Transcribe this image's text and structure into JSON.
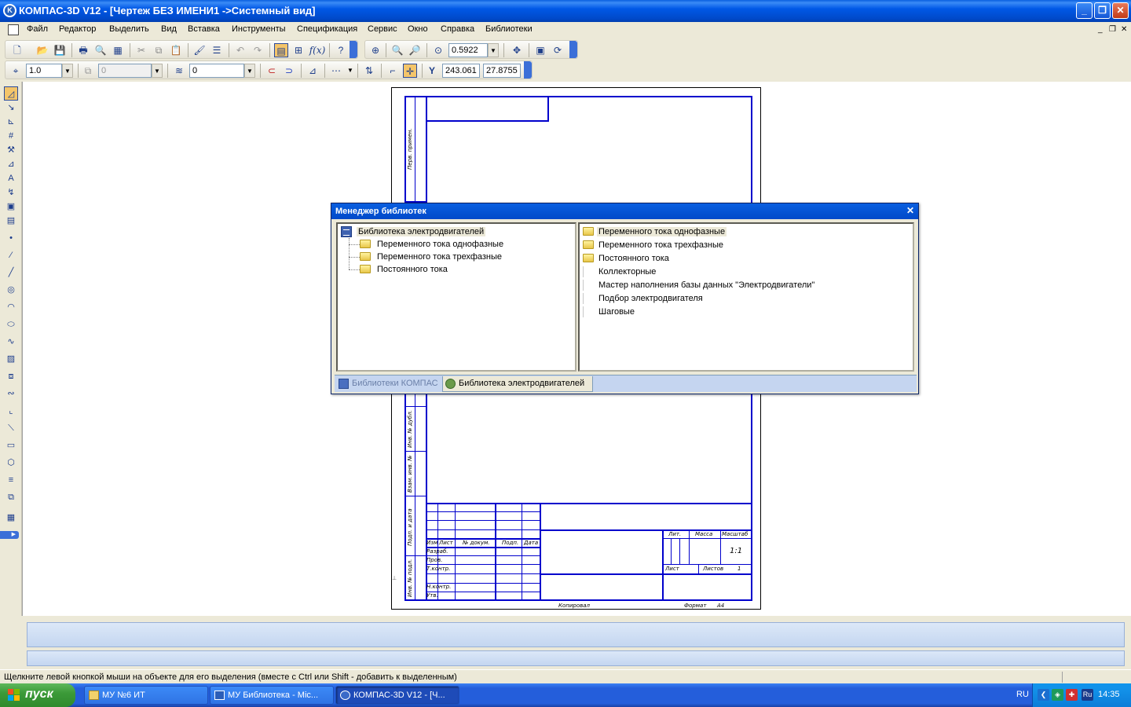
{
  "window": {
    "title": "КОМПАС-3D V12 - [Чертеж БЕЗ ИМЕНИ1 ->Системный вид]",
    "controls": [
      "_",
      "❐",
      "✕"
    ]
  },
  "menu": {
    "items": [
      {
        "label": "Файл",
        "name": "menu-file"
      },
      {
        "label": "Редактор",
        "name": "menu-edit"
      },
      {
        "label": "Выделить",
        "name": "menu-select"
      },
      {
        "label": "Вид",
        "name": "menu-view"
      },
      {
        "label": "Вставка",
        "name": "menu-insert"
      },
      {
        "label": "Инструменты",
        "name": "menu-tools"
      },
      {
        "label": "Спецификация",
        "name": "menu-specification"
      },
      {
        "label": "Сервис",
        "name": "menu-service"
      },
      {
        "label": "Окно",
        "name": "menu-window"
      },
      {
        "label": "Справка",
        "name": "menu-help"
      },
      {
        "label": "Библиотеки",
        "name": "menu-libraries"
      }
    ],
    "mdi_controls": [
      "_",
      "❐",
      "✕"
    ]
  },
  "toolbar1": {
    "zoom_value": "0.5922",
    "fx_label": "f(x)"
  },
  "toolbar2": {
    "line_style_value": "1.0",
    "disabled_value": "0",
    "layer_value": "0",
    "coord_x": "243.061",
    "coord_y": "27.8755",
    "coord_label": "Y"
  },
  "drawing": {
    "stamp": {
      "side_label_top": "Перв. примен.",
      "side_labels": [
        "Инв. № дубл.",
        "Взам. инв. №",
        "Подп. и дата",
        "Инв. № подл."
      ],
      "columns": [
        "Изм",
        "Лист",
        "№ докум.",
        "Подп.",
        "Дата"
      ],
      "rows": [
        "Разраб.",
        "Пров.",
        "Т.контр.",
        "Н.контр.",
        "Утв."
      ],
      "lit_label": "Лит.",
      "mass_label": "Масса",
      "scale_label": "Масштаб",
      "scale_value": "1:1",
      "sheet_label": "Лист",
      "sheets_label": "Листов",
      "sheets_value": "1",
      "copied_label": "Копировал",
      "format_label": "Формат",
      "format_value": "A4"
    }
  },
  "library_manager": {
    "title": "Менеджер библиотек",
    "close_glyph": "✕",
    "tree_root": "Библиотека электродвигателей",
    "tree_children": [
      "Переменного тока однофазные",
      "Переменного тока трехфазные",
      "Постоянного тока"
    ],
    "right_folders": [
      "Переменного тока однофазные",
      "Переменного тока трехфазные",
      "Постоянного тока"
    ],
    "right_items": [
      "Коллекторные",
      "Мастер наполнения базы данных \"Электродвигатели\"",
      "Подбор электродвигателя",
      "Шаговые"
    ],
    "tabs": [
      {
        "label": "Библиотеки КОМПАС",
        "active": false
      },
      {
        "label": "Библиотека электродвигателей",
        "active": true
      }
    ]
  },
  "status": {
    "text": "Щелкните левой кнопкой мыши на объекте для его выделения (вместе с Ctrl или Shift - добавить к выделенным)"
  },
  "taskbar": {
    "start_label": "пуск",
    "tasks": [
      {
        "label": "МУ №6 ИТ",
        "active": false,
        "icon": "folder-icon"
      },
      {
        "label": "МУ Библиотека - Mic...",
        "active": false,
        "icon": "word-icon"
      },
      {
        "label": "КОМПАС-3D V12 - [Ч...",
        "active": true,
        "icon": "kompas-icon"
      }
    ],
    "language": "RU",
    "tray_language": "Ru",
    "clock": "14:35"
  },
  "colors": {
    "drawing_lines": "#0000CC",
    "xp_blue": "#245EDB",
    "active_tool": "#F4C56A"
  }
}
